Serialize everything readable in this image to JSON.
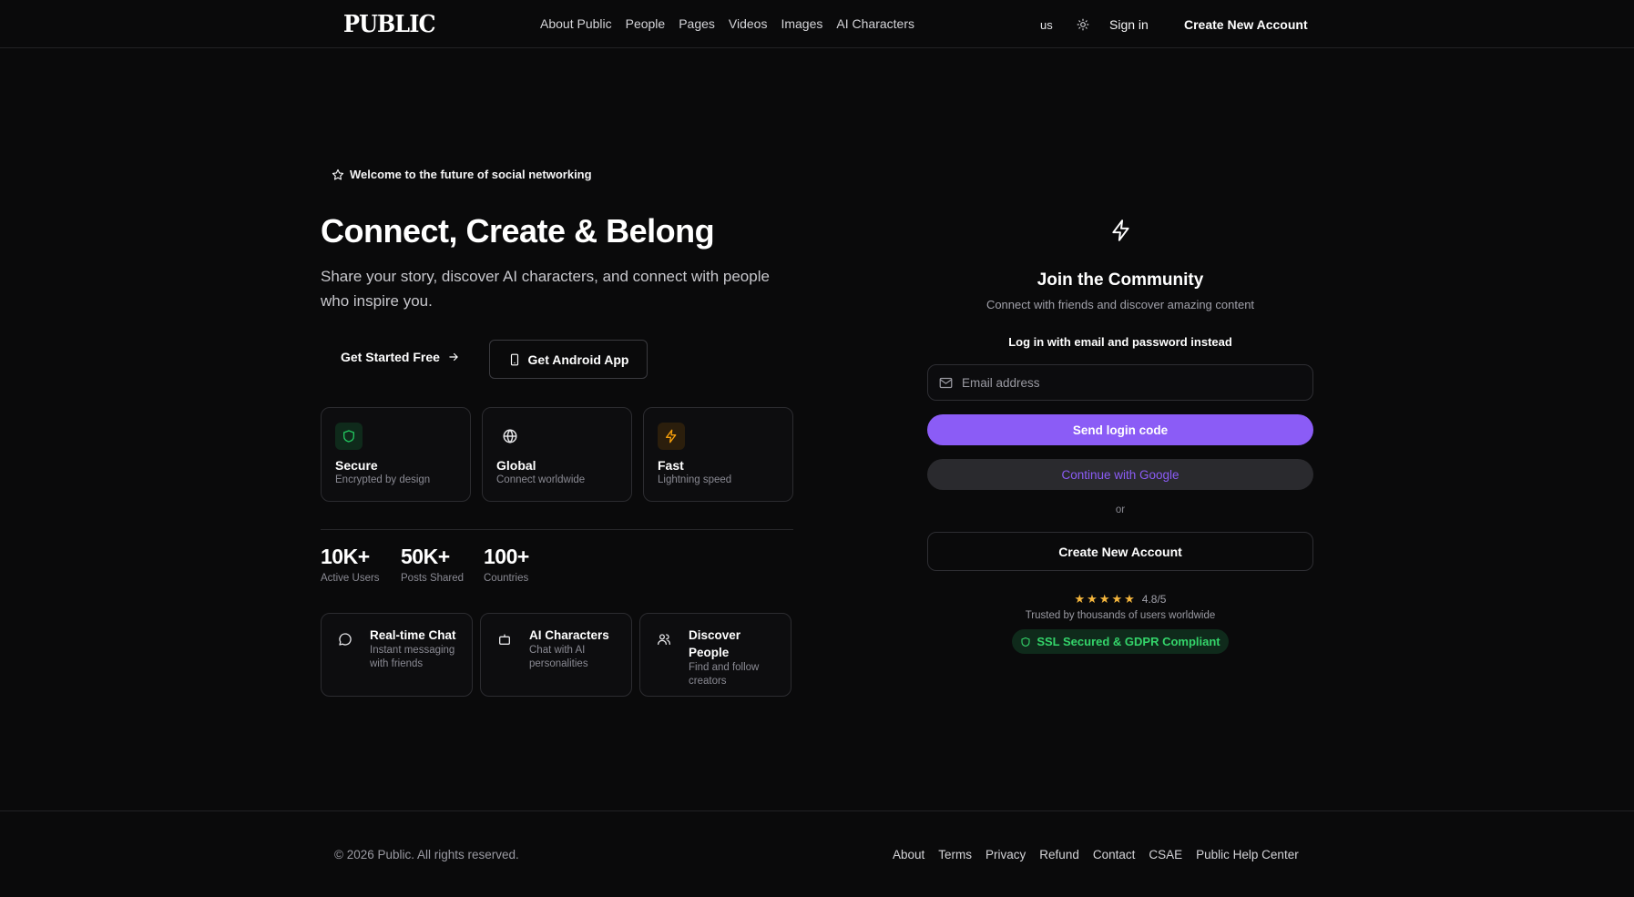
{
  "brand": {
    "logo_text": "PUBLIC"
  },
  "nav": {
    "links": [
      "About Public",
      "People",
      "Pages",
      "Videos",
      "Images",
      "AI Characters"
    ],
    "language": "us",
    "theme_icon": "sun-icon",
    "sign_in": "Sign in",
    "create_account": "Create New Account"
  },
  "hero": {
    "badge_icon": "star-icon",
    "badge": "Welcome to the future of social networking",
    "title": "Connect, Create & Belong",
    "subtitle": "Share your story, discover AI characters, and connect with people who inspire you.",
    "cta_primary": "Get Started Free",
    "cta_secondary": "Get Android App"
  },
  "features": [
    {
      "icon": "shield-icon",
      "title": "Secure",
      "desc": "Encrypted by design",
      "accent": "#22c55e"
    },
    {
      "icon": "globe-icon",
      "title": "Global",
      "desc": "Connect worldwide",
      "accent": "#e4e4e7"
    },
    {
      "icon": "lightning-icon",
      "title": "Fast",
      "desc": "Lightning speed",
      "accent": "#f59e0b"
    }
  ],
  "stats": [
    {
      "value": "10K+",
      "label": "Active Users"
    },
    {
      "value": "50K+",
      "label": "Posts Shared"
    },
    {
      "value": "100+",
      "label": "Countries"
    }
  ],
  "highlights": [
    {
      "icon": "chat-bubble-icon",
      "title": "Real-time Chat",
      "desc": "Instant messaging with friends"
    },
    {
      "icon": "robot-icon",
      "title": "AI Characters",
      "desc": "Chat with AI personalities"
    },
    {
      "icon": "users-icon",
      "title": "Discover People",
      "desc": "Find and follow creators"
    }
  ],
  "auth": {
    "icon": "lightning-icon",
    "title": "Join the Community",
    "subtitle": "Connect with friends and discover amazing content",
    "alt_login": "Log in with email and password instead",
    "email_placeholder": "Email address",
    "email_value": "",
    "send_code": "Send login code",
    "google": "Continue with Google",
    "or": "or",
    "create_account": "Create New Account",
    "rating": "4.8/5",
    "rating_stars": 5,
    "trusted": "Trusted by thousands of users worldwide",
    "ssl": "SSL Secured & GDPR Compliant"
  },
  "footer": {
    "copyright": "© 2026 Public. All rights reserved.",
    "links": [
      "About",
      "Terms",
      "Privacy",
      "Refund",
      "Contact",
      "CSAE",
      "Public Help Center"
    ]
  },
  "colors": {
    "background": "#0a0a0b",
    "accent": "#8b5cf6",
    "success": "#22c55e",
    "star": "#f5b63d"
  }
}
